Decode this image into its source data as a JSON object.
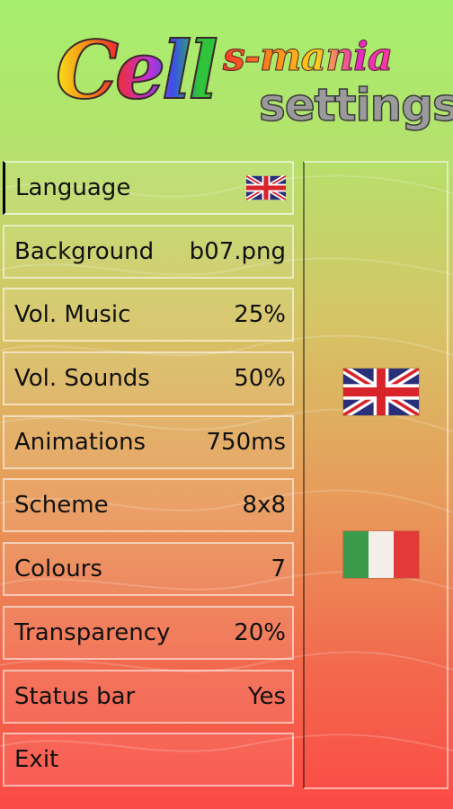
{
  "logo": {
    "word_cell": "Cell",
    "word_smania": "s-mania",
    "word_settings": "settings"
  },
  "menu": [
    {
      "label": "Language",
      "value": "",
      "icon": "uk-flag-icon"
    },
    {
      "label": "Background",
      "value": "b07.png"
    },
    {
      "label": "Vol. Music",
      "value": "25%"
    },
    {
      "label": "Vol. Sounds",
      "value": "50%"
    },
    {
      "label": "Animations",
      "value": "750ms"
    },
    {
      "label": "Scheme",
      "value": "8x8"
    },
    {
      "label": "Colours",
      "value": "7"
    },
    {
      "label": "Transparency",
      "value": "20%"
    },
    {
      "label": "Status bar",
      "value": "Yes"
    },
    {
      "label": "Exit",
      "value": ""
    }
  ],
  "language_options": [
    {
      "name": "english",
      "icon": "uk-flag-icon"
    },
    {
      "name": "italian",
      "icon": "italy-flag-icon"
    }
  ],
  "colors": {
    "top": "#a6ef6e",
    "bottom": "#fb4a45",
    "item_border": "#ffffff"
  }
}
